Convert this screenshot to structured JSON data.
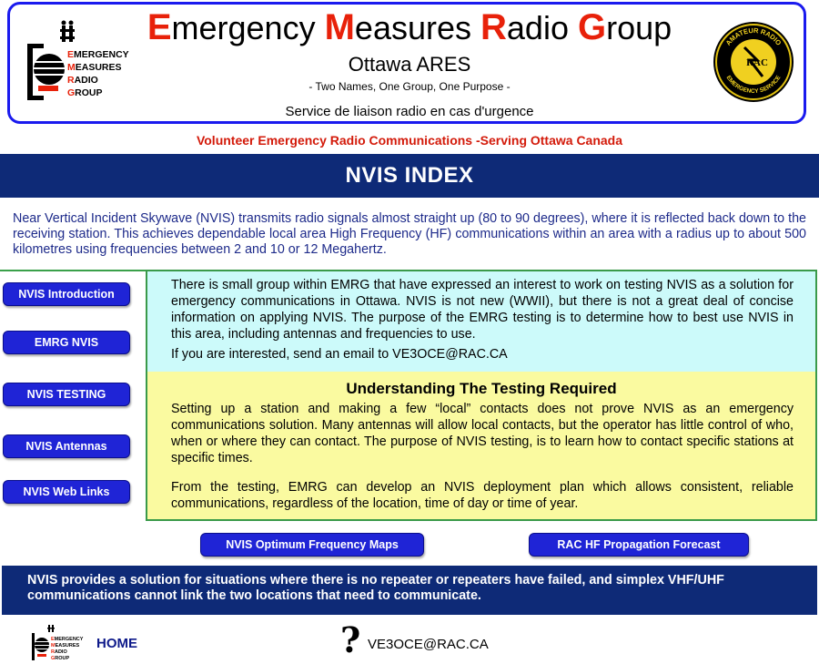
{
  "header": {
    "title_words": [
      {
        "cap": "E",
        "rest": "mergency"
      },
      {
        "cap": "M",
        "rest": "easures"
      },
      {
        "cap": "R",
        "rest": "adio"
      },
      {
        "cap": "G",
        "rest": "roup"
      }
    ],
    "subtitle": "Ottawa ARES",
    "tagline": "- Two Names, One Group, One Purpose -",
    "service_line": "Service de liaison radio en cas d'urgence",
    "logo_lines": [
      "EMERGENCY",
      "MEASURES",
      "RADIO",
      "GROUP"
    ],
    "badge_top": "AMATEUR RADIO",
    "badge_center": "RAC",
    "badge_bottom": "EMERGENCY SERVICE"
  },
  "volunteer_line": "Volunteer Emergency Radio Communications -Serving Ottawa Canada",
  "page_title": "NVIS INDEX",
  "intro": "Near Vertical Incident Skywave (NVIS) transmits radio signals almost straight up (80 to 90 degrees), where it is reflected back down to the receiving station. This achieves dependable local area High Frequency (HF) communications within an area with a radius up to about 500 kilometres using frequencies between 2 and 10 or 12 Megahertz.",
  "nav": [
    {
      "label": "NVIS Introduction"
    },
    {
      "label": "EMRG NVIS"
    },
    {
      "label": "NVIS TESTING"
    },
    {
      "label": "NVIS Antennas"
    },
    {
      "label": "NVIS Web Links"
    }
  ],
  "panel": {
    "interest_text": "There is small group within EMRG that have expressed an interest to work on testing NVIS as a solution for emergency communications in Ottawa. NVIS is not new (WWII), but there is not a great deal of concise information on applying NVIS. The purpose of the EMRG testing is to determine how to best use NVIS in this area, including antennas and frequencies to use.",
    "interest_email": "If you are interested, send an email to VE3OCE@RAC.CA",
    "testing_heading": "Understanding The Testing Required",
    "testing_text_1": "Setting up a station and making a few “local” contacts does not prove NVIS as an emergency communications solution. Many antennas will allow local contacts, but the operator has little control of who, when or where they can contact. The purpose of NVIS testing, is to learn how to contact specific stations at specific times.",
    "testing_text_2": "From the testing, EMRG can develop an NVIS deployment plan which allows consistent, reliable communications, regardless of the location, time of day or time of year."
  },
  "links": {
    "frequency_maps": "NVIS Optimum Frequency Maps",
    "propagation": "RAC HF Propagation Forecast"
  },
  "footer_banner": "NVIS provides a solution for situations where there is no repeater or repeaters have failed, and simplex VHF/UHF communications cannot link the two locations that need to communicate.",
  "footer": {
    "home_label": "HOME",
    "question_mark": "?",
    "email": "VE3OCE@RAC.CA"
  },
  "colors": {
    "banner_navy": "#0e2a77",
    "button_blue": "#1f24d6",
    "accent_red": "#e8210a",
    "panel_cyan": "#ccfafa",
    "panel_yellow": "#fafaa0",
    "panel_border_green": "#3a9a4a"
  }
}
